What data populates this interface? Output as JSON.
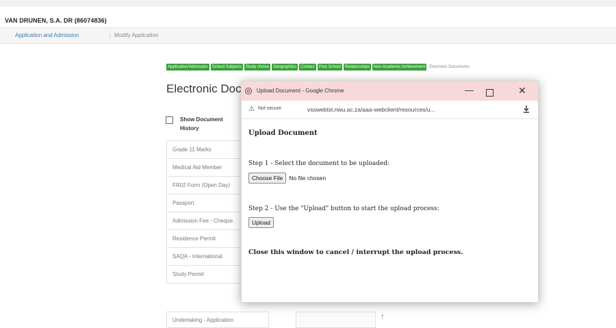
{
  "page": {
    "student_name": "VAN DRUNEN, S.A. DR (86074836)",
    "breadcrumb": [
      "Application and Admission",
      "|",
      "Modify Application"
    ],
    "tabs": [
      {
        "label": "Application/Admission",
        "active": true
      },
      {
        "label": "School Subjects",
        "active": true
      },
      {
        "label": "Study choice",
        "active": true
      },
      {
        "label": "Geographics",
        "active": true
      },
      {
        "label": "Contact",
        "active": true
      },
      {
        "label": "Post School",
        "active": true
      },
      {
        "label": "Relationships",
        "active": true
      },
      {
        "label": "Non-Academic Achievement",
        "active": true
      },
      {
        "label": "Electronic Documents",
        "active": false
      }
    ],
    "heading": "Electronic Documents",
    "show_history_label": "Show Document History",
    "documents": [
      "Grade 11 Marks",
      "Medical Aid Member",
      "FR02 Form (Open Day)",
      "Passport",
      "Admission Fee - Cheque",
      "Residence Permit",
      "SAQA - International",
      "Study Permit"
    ],
    "last_document": "Undertaking - Application",
    "upload_arrow": "↑",
    "colors": {
      "tab_active": "#3aa13a",
      "link": "#3a78b5",
      "titlebar": "#f8d9d9"
    }
  },
  "popup": {
    "window_title": "Upload Document - Google Chrome",
    "controls": {
      "minimize": "—",
      "close": "✕"
    },
    "not_secure": "Not secure",
    "url": "vsswebtst.nwu.ac.za/aaa-webclient/resources/u...",
    "heading": "Upload Document",
    "step1": "Step 1 - Select the document to be uploaded:",
    "choose_file": "Choose File",
    "no_file": "No file chosen",
    "step2": "Step 2 - Use the \"Upload\" button to start the upload process:",
    "upload": "Upload",
    "close_note": "Close this window to cancel / interrupt the upload process."
  }
}
